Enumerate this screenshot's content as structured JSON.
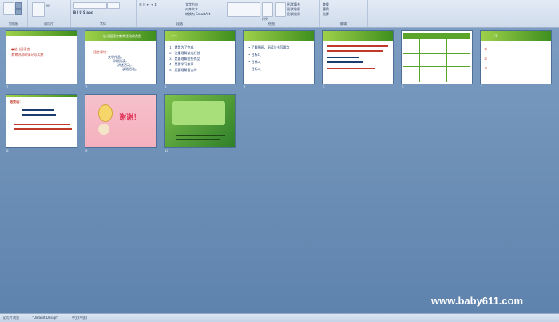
{
  "ribbon": {
    "groups": [
      {
        "label": "剪贴板"
      },
      {
        "label": "幻灯片"
      },
      {
        "label": "字体"
      },
      {
        "label": "段落"
      },
      {
        "label": "绘图"
      },
      {
        "label": "编辑"
      }
    ],
    "new_slide_label": "新建\n幻灯片",
    "shape_label": "形状",
    "arrange_label": "排列",
    "quick_style_label": "快速样式",
    "find_label": "查找",
    "replace_label": "替换",
    "select_label": "选择",
    "text_direction_label": "文字方向",
    "align_text_label": "对齐文本",
    "smartart_label": "转换为 SmartArt",
    "shape_fill_label": "形状填充",
    "shape_outline_label": "形状轮廓",
    "shape_effect_label": "形状效果"
  },
  "slides": [
    {
      "n": "1",
      "lines": [
        "●幼儿园语言",
        "教育活动的设计与实施"
      ]
    },
    {
      "n": "2",
      "title": "幼儿园语言教育活动的类型",
      "lines": [
        "语言领域：",
        "文学作品，",
        "早期阅读，",
        "讲述活动，",
        "谈话活动。"
      ]
    },
    {
      "n": "3",
      "title": "（二）",
      "lines": [
        "1、就是为了完成（",
        ")",
        "2、注重理解幼儿经验",
        "3、是要理解这些作品",
        "4、是要学习故事",
        ")",
        "5、是要理解语言的"
      ]
    },
    {
      "n": "4",
      "title": "",
      "lines": [
        "•  了解图画，阅读与书写要点",
        "•  目标1、",
        "•  目标2、",
        "•  目标3、"
      ]
    },
    {
      "n": "5",
      "title": "",
      "lines": [
        "",
        "",
        "",
        ""
      ]
    },
    {
      "n": "6",
      "title": "",
      "lines": []
    },
    {
      "n": "7",
      "title": "（2）",
      "lines": [
        "1）",
        "2）",
        "3）"
      ]
    },
    {
      "n": "8",
      "title": "结束语：",
      "lines": [
        "",
        "",
        "",
        ""
      ]
    },
    {
      "n": "9",
      "title": "谢谢！",
      "lines": []
    },
    {
      "n": "10",
      "title": "",
      "lines": [
        "",
        ""
      ]
    }
  ],
  "status": {
    "slide_info": "幻灯片浏览",
    "theme": "\"Default Design\"",
    "lang": "中文(中国)"
  },
  "watermark": "www.baby611.com",
  "colors": {
    "ribbon_bg": "#dce6f3",
    "workspace": "#6e8fb4",
    "green": "#5aa52a"
  }
}
